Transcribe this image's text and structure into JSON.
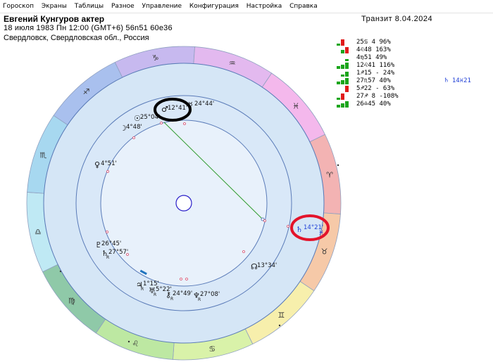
{
  "menu": [
    "Гороскоп",
    "Экраны",
    "Таблицы",
    "Разное",
    "Управление",
    "Конфигурация",
    "Настройка",
    "Справка"
  ],
  "header": {
    "name": "Евгений Кунгуров актер",
    "line2": "18 июля 1983  Пн  12:00 (GMT+6) 56n51  60e36",
    "line3": "Свердловск, Свердловская обл., Россия",
    "transit": "Транзит  8.04.2024"
  },
  "colors": {
    "fire": "#f3b3b3",
    "earth": "#a8d9a5",
    "air": "#bfe9f4",
    "water": "#f4b8ec",
    "house_ring": "#d5e6f6",
    "inner_disc": "#e8f1fb",
    "aspect_line": "#2e9b2e",
    "highlight_black": "#000000",
    "highlight_red": "#e3142b",
    "transit_blue": "#1f3fd6"
  },
  "zodiac": [
    {
      "glyph": "♈",
      "color": "#f3b3b3"
    },
    {
      "glyph": "♉",
      "color": "#f6c9a8"
    },
    {
      "glyph": "♊",
      "color": "#f7efac"
    },
    {
      "glyph": "♋",
      "color": "#d9f2a9"
    },
    {
      "glyph": "♌",
      "color": "#bde8a2"
    },
    {
      "glyph": "♍",
      "color": "#8fc9a8"
    },
    {
      "glyph": "♎",
      "color": "#bfe9f4"
    },
    {
      "glyph": "♏",
      "color": "#a7d8f0"
    },
    {
      "glyph": "♐",
      "color": "#a9c0ee"
    },
    {
      "glyph": "♑",
      "color": "#c7b9ef"
    },
    {
      "glyph": "♒",
      "color": "#e3b9ef"
    },
    {
      "glyph": "♓",
      "color": "#f4b8ec"
    }
  ],
  "planets": [
    {
      "name": "sun",
      "glyph": "☉",
      "label": "25°04'"
    },
    {
      "name": "mars",
      "glyph": "♂",
      "label": "12°41'"
    },
    {
      "name": "mercury",
      "glyph": "☿",
      "label": "24°44'"
    },
    {
      "name": "moon",
      "glyph": "☽",
      "label": "4°48'"
    },
    {
      "name": "venus",
      "glyph": "♀",
      "label": "4°51'"
    },
    {
      "name": "pluto",
      "glyph": "♇",
      "label": "26°45'"
    },
    {
      "name": "saturn",
      "glyph": "♄",
      "label": "27°57'"
    },
    {
      "name": "jupiter",
      "glyph": "♃",
      "label": "1°15'"
    },
    {
      "name": "uranus",
      "glyph": "♅",
      "label": "5°22'"
    },
    {
      "name": "chiron",
      "glyph": "⚷",
      "label": "24°49'"
    },
    {
      "name": "neptune",
      "glyph": "♆",
      "label": "27°08'"
    },
    {
      "name": "node",
      "glyph": "☊",
      "label": "13°34'"
    }
  ],
  "transit_planet": {
    "glyph": "♄",
    "label": "14°21'",
    "sign": "♓"
  },
  "retro_mark": "R",
  "table": [
    {
      "glyph": "☉",
      "text": "25♋ 4   96%",
      "extra": ""
    },
    {
      "glyph": "☽",
      "text": " 4♌48  163%",
      "extra": ""
    },
    {
      "glyph": "☿",
      "text": " 4♍51   49%",
      "extra": ""
    },
    {
      "glyph": "♂",
      "text": "12♌41  116%",
      "extra": ""
    },
    {
      "glyph": "♃",
      "text": " 1♐15 - 24%",
      "extra": ""
    },
    {
      "glyph": "♄",
      "text": "27♏57   40%",
      "extra": "♄  14♓21"
    },
    {
      "glyph": "♅",
      "text": " 5♐22 - 63%",
      "extra": ""
    },
    {
      "glyph": "♆",
      "text": "27♐ 8 -108%",
      "extra": ""
    },
    {
      "glyph": "☊",
      "text": "26♎45   40%",
      "extra": ""
    }
  ]
}
